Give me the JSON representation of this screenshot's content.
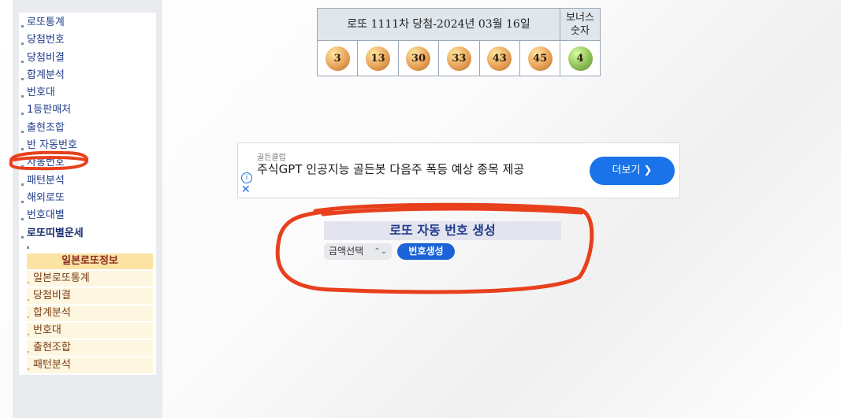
{
  "sidebar": {
    "items": [
      {
        "label": "로또통계"
      },
      {
        "label": "당첨번호"
      },
      {
        "label": "당첨비결"
      },
      {
        "label": "합계분석"
      },
      {
        "label": "번호대"
      },
      {
        "label": "1등판매처"
      },
      {
        "label": "출현조합"
      },
      {
        "label": "반 자동번호"
      },
      {
        "label": "자동번호"
      },
      {
        "label": "패턴분석"
      },
      {
        "label": "해외로또"
      },
      {
        "label": "번호대별"
      },
      {
        "label": "로또띠별운세"
      }
    ],
    "japan_title": "일본로또정보",
    "japan_items": [
      {
        "label": "일본로또통계"
      },
      {
        "label": "당첨비결"
      },
      {
        "label": "합계분석"
      },
      {
        "label": "번호대"
      },
      {
        "label": "출현조합"
      },
      {
        "label": "패턴분석"
      }
    ]
  },
  "lotto": {
    "title": "로또 1111차 당첨-2024년 03월 16일",
    "bonus_header": "보너스 숫자",
    "numbers": [
      "3",
      "13",
      "30",
      "33",
      "43",
      "45"
    ],
    "bonus": "4",
    "colors": {
      "ball": "#e8a25a",
      "bonus_ball": "#8fbf5a"
    }
  },
  "ad": {
    "sponsor": "골든클럽",
    "headline": "주식GPT 인공지능 골든봇 다음주 폭등 예상 종목 제공",
    "button": "더보기 ❯"
  },
  "generator": {
    "title": "로또 자동 번호 생성",
    "select_value": "금액선택",
    "button": "번호생성"
  },
  "annotation": {
    "color": "#e8401c"
  }
}
